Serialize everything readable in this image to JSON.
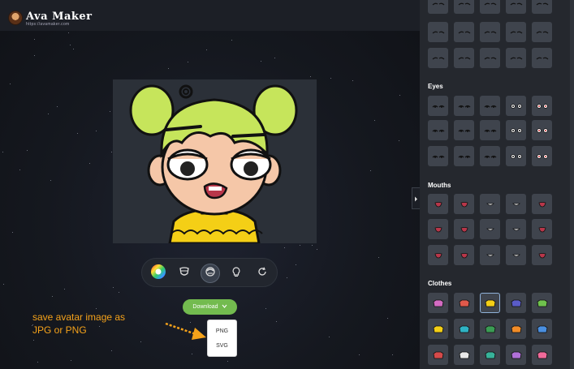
{
  "app": {
    "name": "Ava Maker",
    "url": "https://avamaker.com"
  },
  "toolbar": {
    "buttons": [
      {
        "icon": "color-wheel-icon"
      },
      {
        "icon": "face-outline-icon"
      },
      {
        "icon": "hair-icon",
        "active": true
      },
      {
        "icon": "lightbulb-icon"
      },
      {
        "icon": "refresh-icon"
      }
    ]
  },
  "download": {
    "label": "Download",
    "options": [
      "PNG",
      "SVG"
    ]
  },
  "annotation": {
    "line1": "save avatar image as",
    "line2": "JPG or PNG"
  },
  "panel": {
    "sections": [
      {
        "title": "Eyes"
      },
      {
        "title": "Mouths"
      },
      {
        "title": "Clothes"
      }
    ]
  },
  "colors": {
    "accent_green": "#73bb4f",
    "annotation_orange": "#f5a21a",
    "hair_lime": "#c6e55b",
    "shirt_yellow": "#f4cf16"
  }
}
